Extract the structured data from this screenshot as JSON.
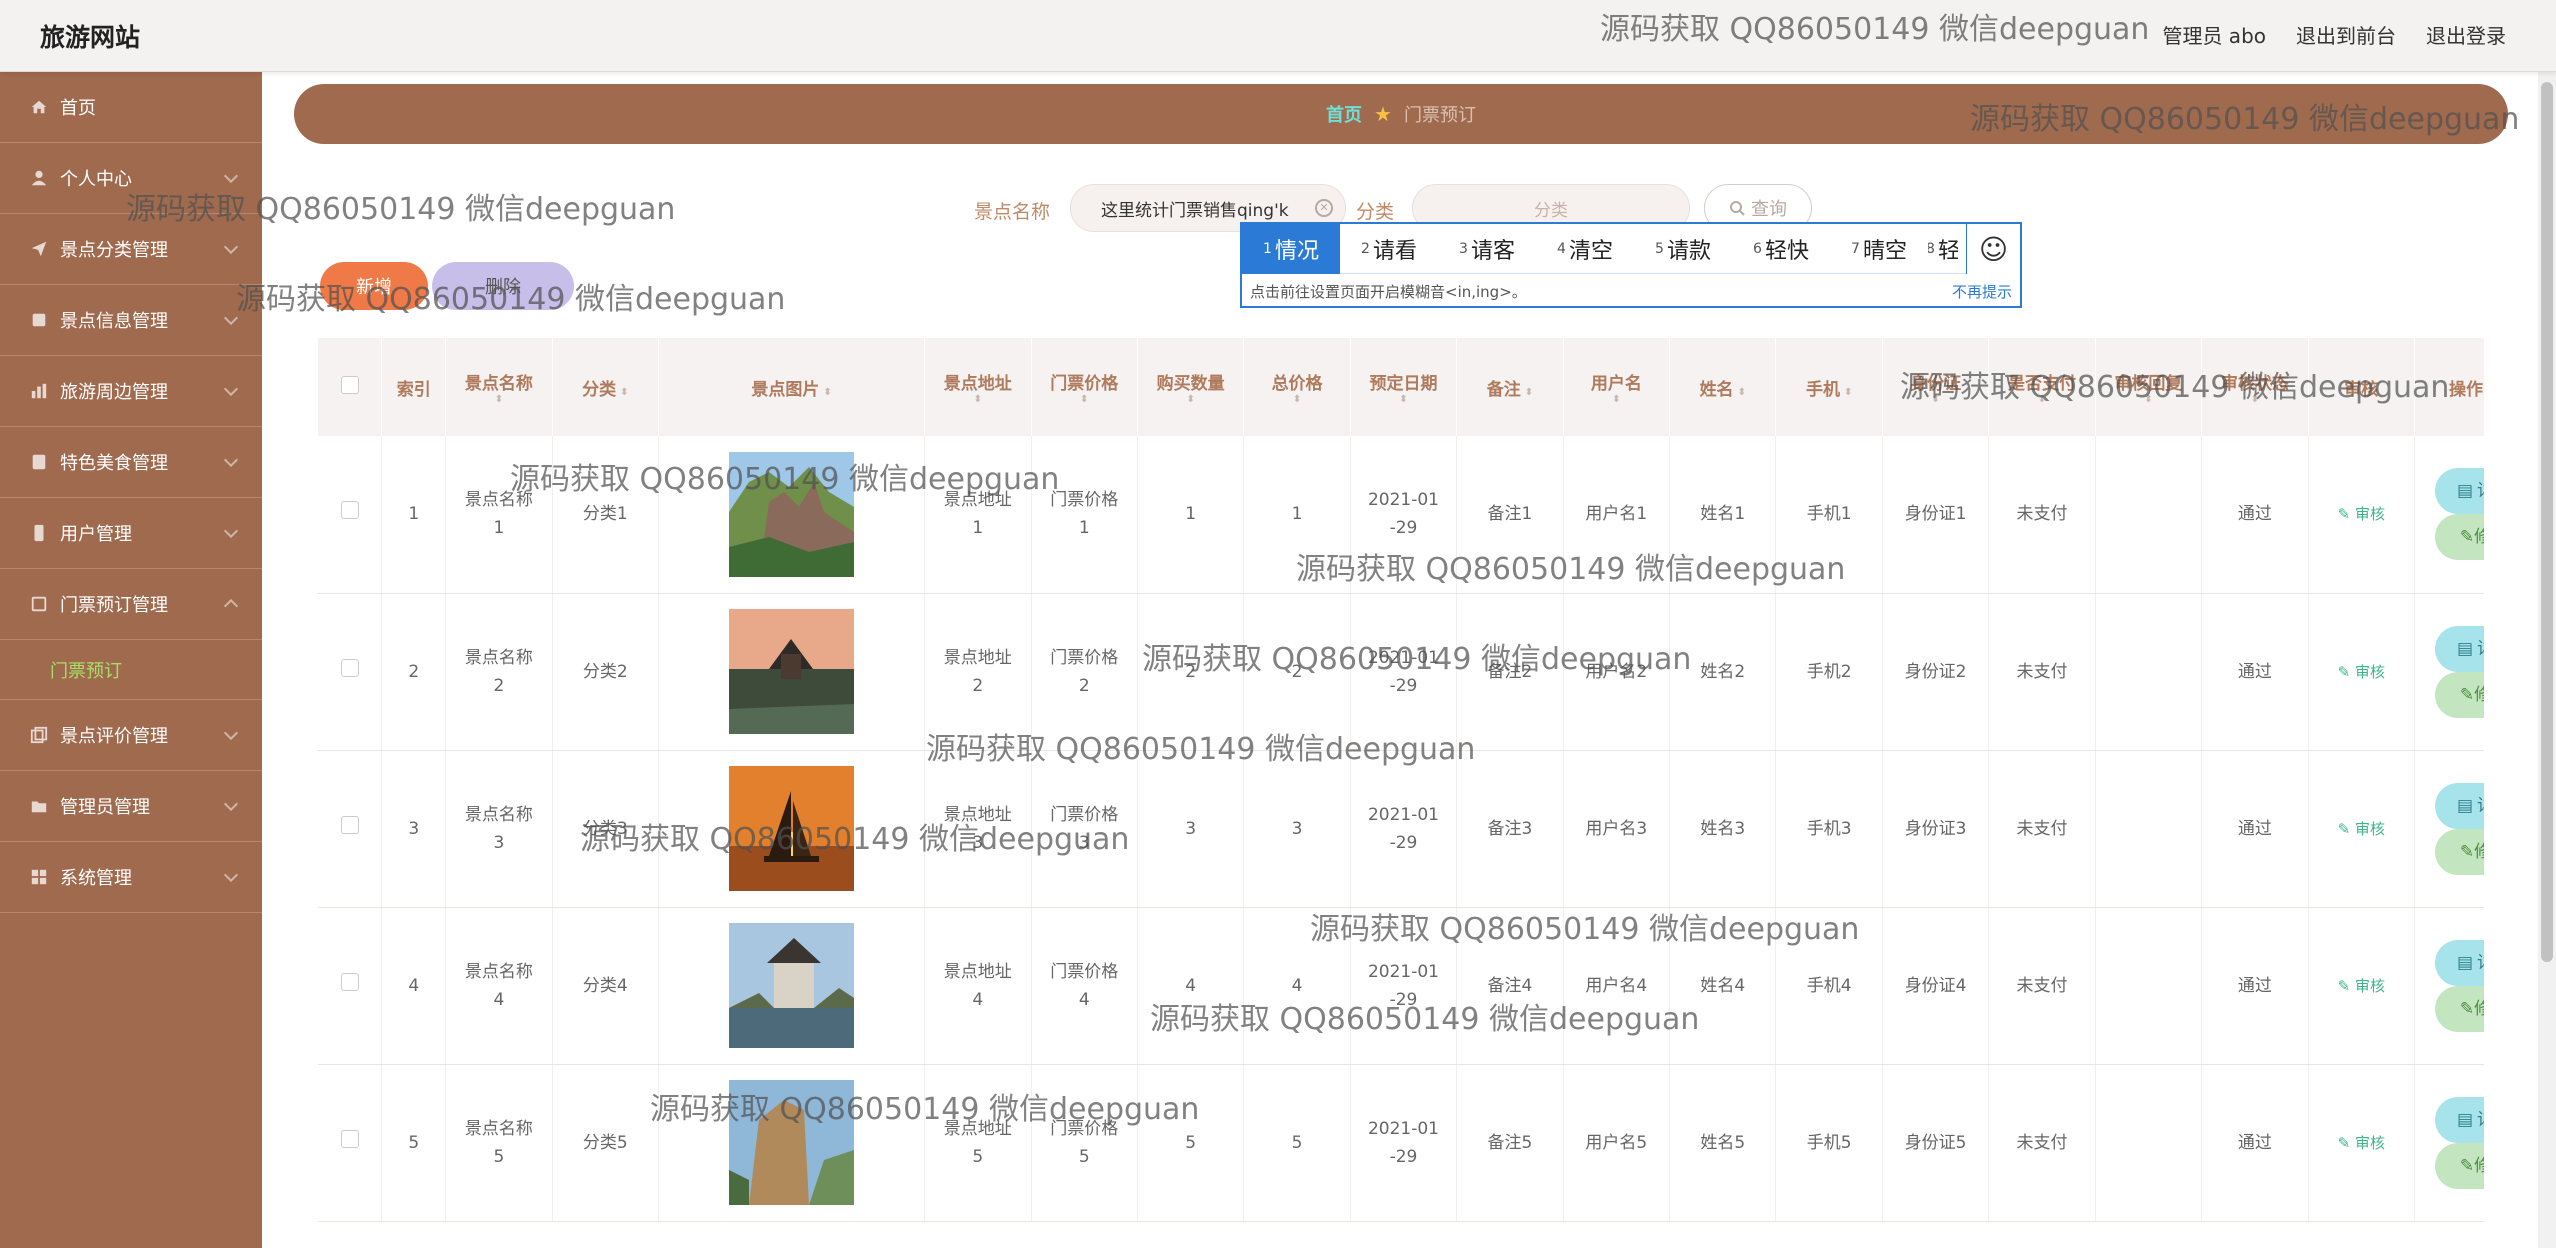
{
  "header": {
    "site_title": "旅游网站",
    "admin": "管理员 abo",
    "to_front": "退出到前台",
    "logout": "退出登录"
  },
  "sidebar": {
    "items": [
      {
        "label": "首页",
        "icon": "home-icon"
      },
      {
        "label": "个人中心",
        "icon": "user-icon"
      },
      {
        "label": "景点分类管理",
        "icon": "send-icon"
      },
      {
        "label": "景点信息管理",
        "icon": "file-icon"
      },
      {
        "label": "旅游周边管理",
        "icon": "chart-icon"
      },
      {
        "label": "特色美食管理",
        "icon": "note-icon"
      },
      {
        "label": "用户管理",
        "icon": "mobile-icon"
      },
      {
        "label": "门票预订管理",
        "icon": "ticket-icon"
      },
      {
        "label": "景点评价管理",
        "icon": "copy-icon"
      },
      {
        "label": "管理员管理",
        "icon": "folder-icon"
      },
      {
        "label": "系统管理",
        "icon": "grid-icon"
      }
    ],
    "sub_item": "门票预订"
  },
  "breadcrumb": {
    "home": "首页",
    "current": "门票预订"
  },
  "search": {
    "name_label": "景点名称",
    "name_value": "这里统计门票销售qing'k",
    "category_label": "分类",
    "category_placeholder": "分类",
    "query_button": "查询"
  },
  "actions": {
    "add": "新增",
    "delete": "删除"
  },
  "ime": {
    "candidates": [
      {
        "num": "1",
        "text": "情况"
      },
      {
        "num": "2",
        "text": "请看"
      },
      {
        "num": "3",
        "text": "请客"
      },
      {
        "num": "4",
        "text": "清空"
      },
      {
        "num": "5",
        "text": "请款"
      },
      {
        "num": "6",
        "text": "轻快"
      },
      {
        "num": "7",
        "text": "晴空"
      },
      {
        "num": "8",
        "text": "轻"
      }
    ],
    "hint": "点击前往设置页面开启模糊音<in,ing>。",
    "no_remind": "不再提示"
  },
  "table": {
    "headers": [
      "索引",
      "景点名称",
      "分类",
      "景点图片",
      "景点地址",
      "门票价格",
      "购买数量",
      "总价格",
      "预定日期",
      "备注",
      "用户名",
      "姓名",
      "手机",
      "身份证",
      "是否支付",
      "审核回复",
      "审核状态",
      "审核",
      "操作"
    ],
    "rows": [
      {
        "index": "1",
        "name": "景点名称\n1",
        "category": "分类1",
        "address": "景点地址\n1",
        "price": "门票价格\n1",
        "qty": "1",
        "total": "1",
        "date": "2021-01\n-29",
        "note": "备注1",
        "username": "用户名1",
        "realname": "姓名1",
        "phone": "手机1",
        "idcard": "身份证1",
        "paid": "未支付",
        "reply": "",
        "status": "通过",
        "audit": "审核",
        "detail": "详情",
        "edit": "修改",
        "img": "mountain"
      },
      {
        "index": "2",
        "name": "景点名称\n2",
        "category": "分类2",
        "address": "景点地址\n2",
        "price": "门票价格\n2",
        "qty": "2",
        "total": "2",
        "date": "2021-01\n-29",
        "note": "备注2",
        "username": "用户名2",
        "realname": "姓名2",
        "phone": "手机2",
        "idcard": "身份证2",
        "paid": "未支付",
        "reply": "",
        "status": "通过",
        "audit": "审核",
        "detail": "详情",
        "edit": "修改",
        "img": "pagoda"
      },
      {
        "index": "3",
        "name": "景点名称\n3",
        "category": "分类3",
        "address": "景点地址\n3",
        "price": "门票价格\n3",
        "qty": "3",
        "total": "3",
        "date": "2021-01\n-29",
        "note": "备注3",
        "username": "用户名3",
        "realname": "姓名3",
        "phone": "手机3",
        "idcard": "身份证3",
        "paid": "未支付",
        "reply": "",
        "status": "通过",
        "audit": "审核",
        "detail": "详情",
        "edit": "修改",
        "img": "sunset"
      },
      {
        "index": "4",
        "name": "景点名称\n4",
        "category": "分类4",
        "address": "景点地址\n4",
        "price": "门票价格\n4",
        "qty": "4",
        "total": "4",
        "date": "2021-01\n-29",
        "note": "备注4",
        "username": "用户名4",
        "realname": "姓名4",
        "phone": "手机4",
        "idcard": "身份证4",
        "paid": "未支付",
        "reply": "",
        "status": "通过",
        "audit": "审核",
        "detail": "详情",
        "edit": "修改",
        "img": "tower"
      },
      {
        "index": "5",
        "name": "景点名称\n5",
        "category": "分类5",
        "address": "景点地址\n5",
        "price": "门票价格\n5",
        "qty": "5",
        "total": "5",
        "date": "2021-01\n-29",
        "note": "备注5",
        "username": "用户名5",
        "realname": "姓名5",
        "phone": "手机5",
        "idcard": "身份证5",
        "paid": "未支付",
        "reply": "",
        "status": "通过",
        "audit": "审核",
        "detail": "详情",
        "edit": "修改",
        "img": "cliff"
      }
    ]
  },
  "watermark": "源码获取 QQ86050149 微信deepguan",
  "colors": {
    "sidebar": "#a06a4e",
    "accent_green": "#a7e067",
    "add": "#ef7a47",
    "delete": "#c7bfe9",
    "ime_blue": "#2b7bd6"
  }
}
